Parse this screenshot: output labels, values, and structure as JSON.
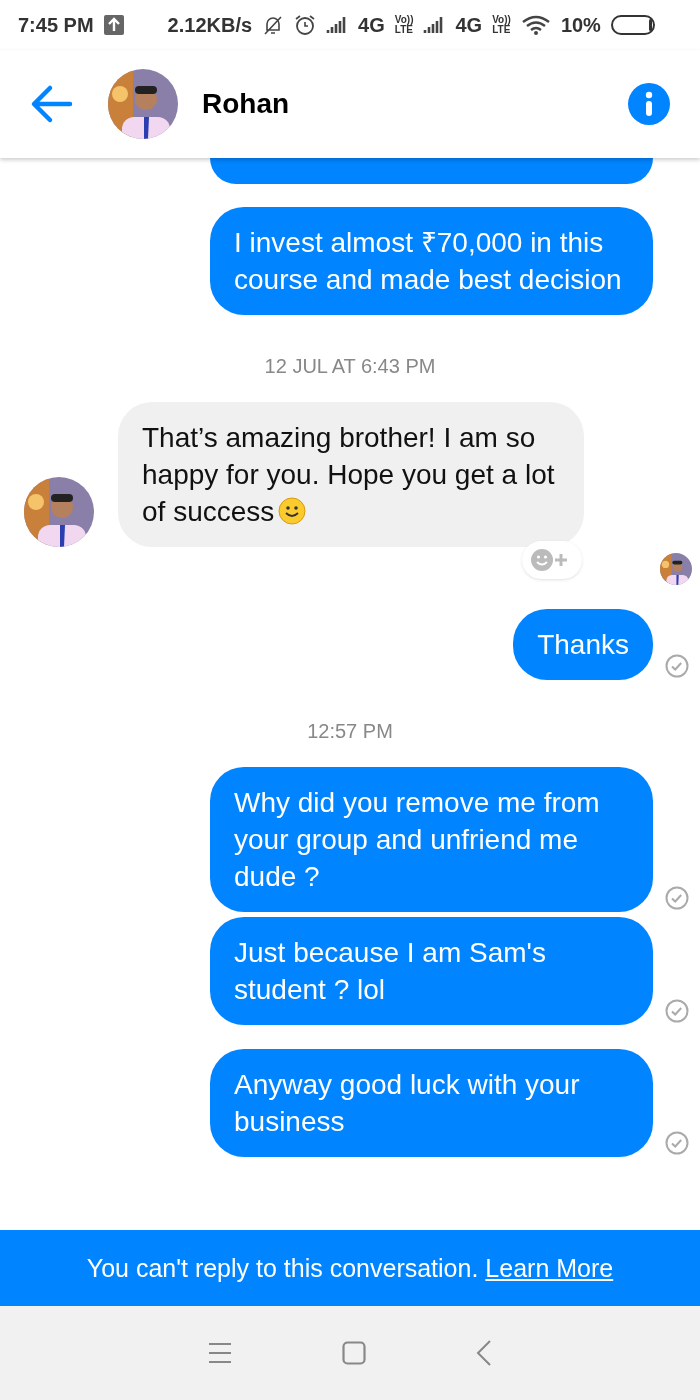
{
  "status_bar": {
    "time": "7:45 PM",
    "speed": "2.12KB/s",
    "networks": [
      {
        "type": "4G",
        "volte_top": "Vo))",
        "volte_bottom": "LTE"
      },
      {
        "type": "4G",
        "volte_top": "Vo))",
        "volte_bottom": "LTE"
      }
    ],
    "battery": "10%"
  },
  "header": {
    "name": "Rohan"
  },
  "messages": [
    {
      "kind": "sent_cut"
    },
    {
      "kind": "sent",
      "text": "I invest almost ₹70,000 in this course and made best decision",
      "delivered": false
    },
    {
      "kind": "timestamp",
      "text": "12 JUL AT 6:43 PM"
    },
    {
      "kind": "received",
      "text": "That’s amazing brother! I am so happy for you. Hope you get a lot of success",
      "emoji": true,
      "seen_by_avatar": true
    },
    {
      "kind": "sent",
      "text": "Thanks",
      "delivered": true
    },
    {
      "kind": "timestamp",
      "text": "12:57 PM"
    },
    {
      "kind": "sent",
      "text": "Why did you remove me from your group and unfriend me dude ?",
      "delivered": true
    },
    {
      "kind": "sent",
      "text": "Just because I am Sam's student ? lol",
      "delivered": true
    },
    {
      "kind": "sent",
      "text": "Anyway good luck with your business",
      "delivered": true
    }
  ],
  "banner": {
    "text": "You can't reply to this conversation.",
    "link": "Learn More"
  }
}
